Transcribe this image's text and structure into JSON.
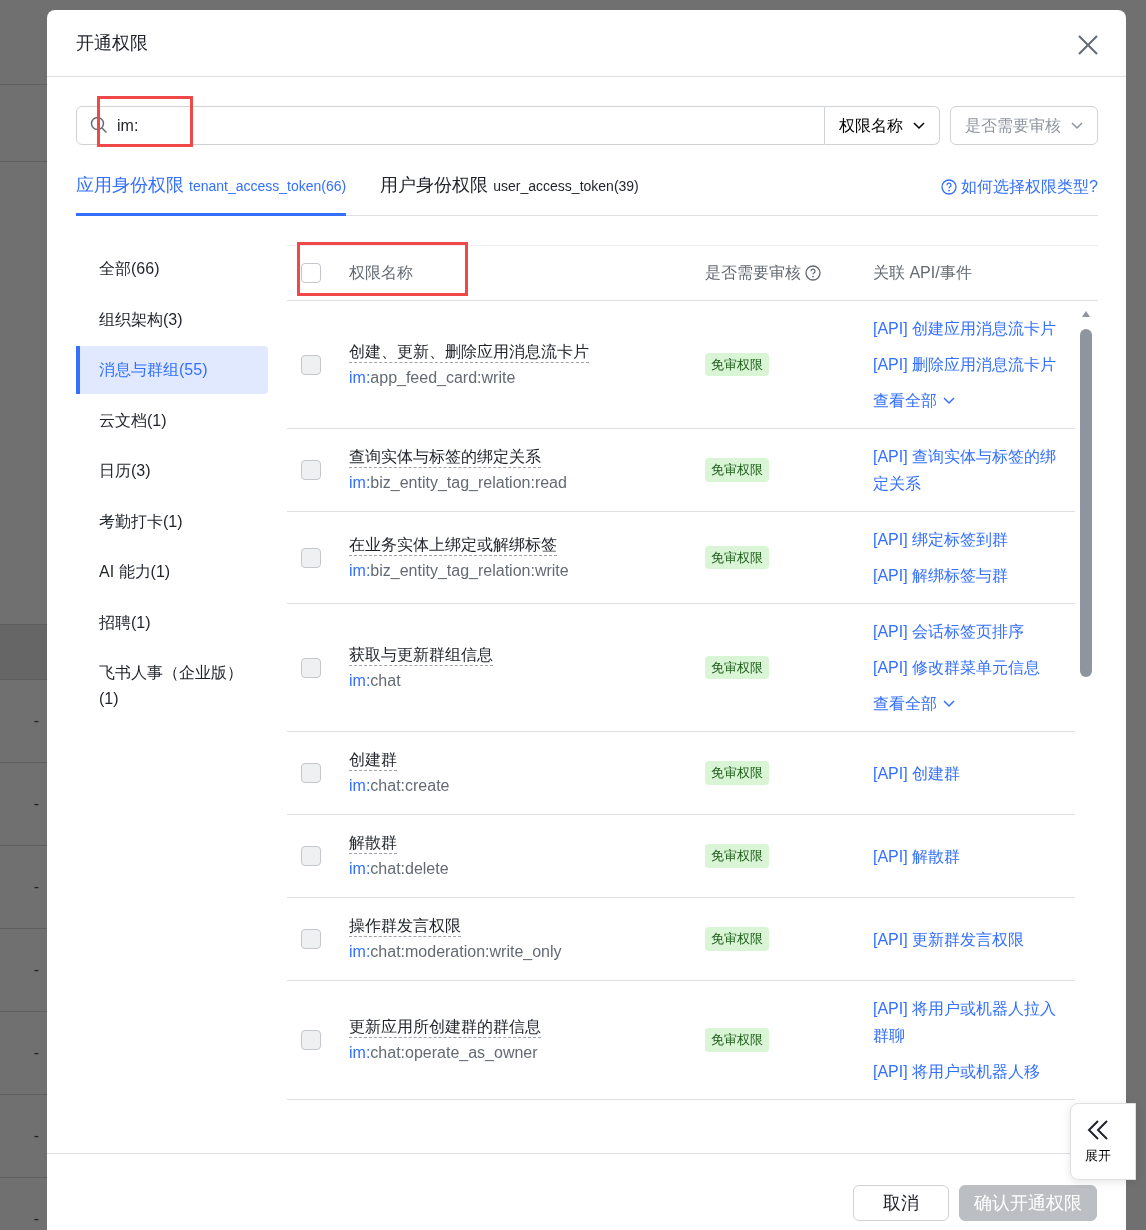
{
  "background": {
    "row_marks": [
      "-",
      "-",
      "-",
      "-",
      "-",
      "-",
      "-"
    ]
  },
  "dialog": {
    "title": "开通权限"
  },
  "search": {
    "value": "im:",
    "highlighted": true
  },
  "filters": [
    {
      "value": "权限名称"
    },
    {
      "placeholder": "是否需要审核"
    }
  ],
  "tabs": [
    {
      "label": "应用身份权限",
      "token": "tenant_access_token(66)",
      "selected": true
    },
    {
      "label": "用户身份权限",
      "token": "user_access_token(39)",
      "selected": false
    }
  ],
  "help_link": "如何选择权限类型?",
  "categories": [
    {
      "label": "全部(66)",
      "selected": false
    },
    {
      "label": "组织架构(3)",
      "selected": false
    },
    {
      "label": "消息与群组(55)",
      "selected": true
    },
    {
      "label": "云文档(1)",
      "selected": false
    },
    {
      "label": "日历(3)",
      "selected": false
    },
    {
      "label": "考勤打卡(1)",
      "selected": false
    },
    {
      "label": "AI 能力(1)",
      "selected": false
    },
    {
      "label": "招聘(1)",
      "selected": false
    },
    {
      "label": "飞书人事（企业版）(1)",
      "selected": false
    }
  ],
  "table": {
    "select_all": {
      "checked": false
    },
    "header_highlighted": true,
    "columns": [
      {
        "label": "权限名称",
        "help": false
      },
      {
        "label": "是否需要审核",
        "help": true
      },
      {
        "label": "关联 API/事件",
        "help": false
      }
    ],
    "rows": [
      {
        "checked": false,
        "name": "创建、更新、删除应用消息流卡片",
        "scope_prefix": "im:",
        "scope": "app_feed_card:write",
        "review": "免审权限",
        "apis": [
          "[API] 创建应用消息流卡片",
          "[API] 删除应用消息流卡片"
        ],
        "more": "查看全部"
      },
      {
        "checked": false,
        "name": "查询实体与标签的绑定关系",
        "scope_prefix": "im:",
        "scope": "biz_entity_tag_relation:read",
        "review": "免审权限",
        "apis": [
          "[API] 查询实体与标签的绑定关系"
        ]
      },
      {
        "checked": false,
        "name": "在业务实体上绑定或解绑标签",
        "scope_prefix": "im:",
        "scope": "biz_entity_tag_relation:write",
        "review": "免审权限",
        "apis": [
          "[API] 绑定标签到群",
          "[API] 解绑标签与群"
        ]
      },
      {
        "checked": false,
        "name": "获取与更新群组信息",
        "scope_prefix": "im:",
        "scope": "chat",
        "review": "免审权限",
        "apis": [
          "[API] 会话标签页排序",
          "[API] 修改群菜单元信息"
        ],
        "more": "查看全部"
      },
      {
        "checked": false,
        "name": "创建群",
        "scope_prefix": "im:",
        "scope": "chat:create",
        "review": "免审权限",
        "apis": [
          "[API] 创建群"
        ]
      },
      {
        "checked": false,
        "name": "解散群",
        "scope_prefix": "im:",
        "scope": "chat:delete",
        "review": "免审权限",
        "apis": [
          "[API] 解散群"
        ]
      },
      {
        "checked": false,
        "name": "操作群发言权限",
        "scope_prefix": "im:",
        "scope": "chat:moderation:write_only",
        "review": "免审权限",
        "apis": [
          "[API] 更新群发言权限"
        ]
      },
      {
        "checked": false,
        "name": "更新应用所创建群的群信息",
        "scope_prefix": "im:",
        "scope": "chat:operate_as_owner",
        "review": "免审权限",
        "apis": [
          "[API] 将用户或机器人拉入群聊",
          "[API] 将用户或机器人移"
        ]
      }
    ]
  },
  "expand_button": "展开",
  "footer": [
    {
      "label": "取消",
      "disabled": false
    },
    {
      "label": "确认开通权限",
      "disabled": true
    }
  ]
}
